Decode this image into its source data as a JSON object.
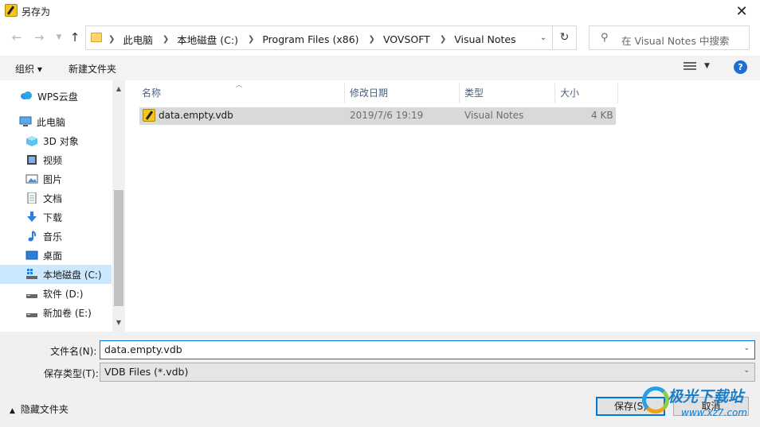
{
  "window": {
    "title": "另存为",
    "close_icon": "close-icon"
  },
  "nav": {
    "back_icon": "arrow-left-icon",
    "forward_icon": "arrow-right-icon",
    "recent_icon": "chevron-down-icon",
    "up_icon": "arrow-up-icon",
    "breadcrumbs": [
      "此电脑",
      "本地磁盘 (C:)",
      "Program Files (x86)",
      "VOVSOFT",
      "Visual Notes"
    ],
    "refresh_icon": "refresh-icon",
    "search_placeholder": "在 Visual Notes 中搜索"
  },
  "toolbar": {
    "organize": "组织 ▾",
    "new_folder": "新建文件夹",
    "help": "?"
  },
  "sidebar": {
    "items": [
      {
        "label": "WPS云盘",
        "icon": "cloud-icon"
      },
      {
        "label": "此电脑",
        "icon": "computer-icon"
      },
      {
        "label": "3D 对象",
        "icon": "cube-icon"
      },
      {
        "label": "视频",
        "icon": "video-icon"
      },
      {
        "label": "图片",
        "icon": "picture-icon"
      },
      {
        "label": "文档",
        "icon": "document-icon"
      },
      {
        "label": "下载",
        "icon": "download-icon"
      },
      {
        "label": "音乐",
        "icon": "music-icon"
      },
      {
        "label": "桌面",
        "icon": "desktop-icon"
      },
      {
        "label": "本地磁盘 (C:)",
        "icon": "drive-icon",
        "selected": true
      },
      {
        "label": "软件 (D:)",
        "icon": "drive-icon"
      },
      {
        "label": "新加卷 (E:)",
        "icon": "drive-icon"
      }
    ]
  },
  "files": {
    "columns": [
      "名称",
      "修改日期",
      "类型",
      "大小"
    ],
    "rows": [
      {
        "name": "data.empty.vdb",
        "modified": "2019/7/6 19:19",
        "type": "Visual Notes",
        "size": "4 KB"
      }
    ]
  },
  "form": {
    "filename_label": "文件名(N):",
    "filename_value": "data.empty.vdb",
    "filetype_label": "保存类型(T):",
    "filetype_value": "VDB Files (*.vdb)",
    "hide_folders": "隐藏文件夹",
    "save": "保存(S)",
    "cancel": "取消"
  },
  "watermark": {
    "text": "极光下载站",
    "url": "www.xz7.com"
  }
}
